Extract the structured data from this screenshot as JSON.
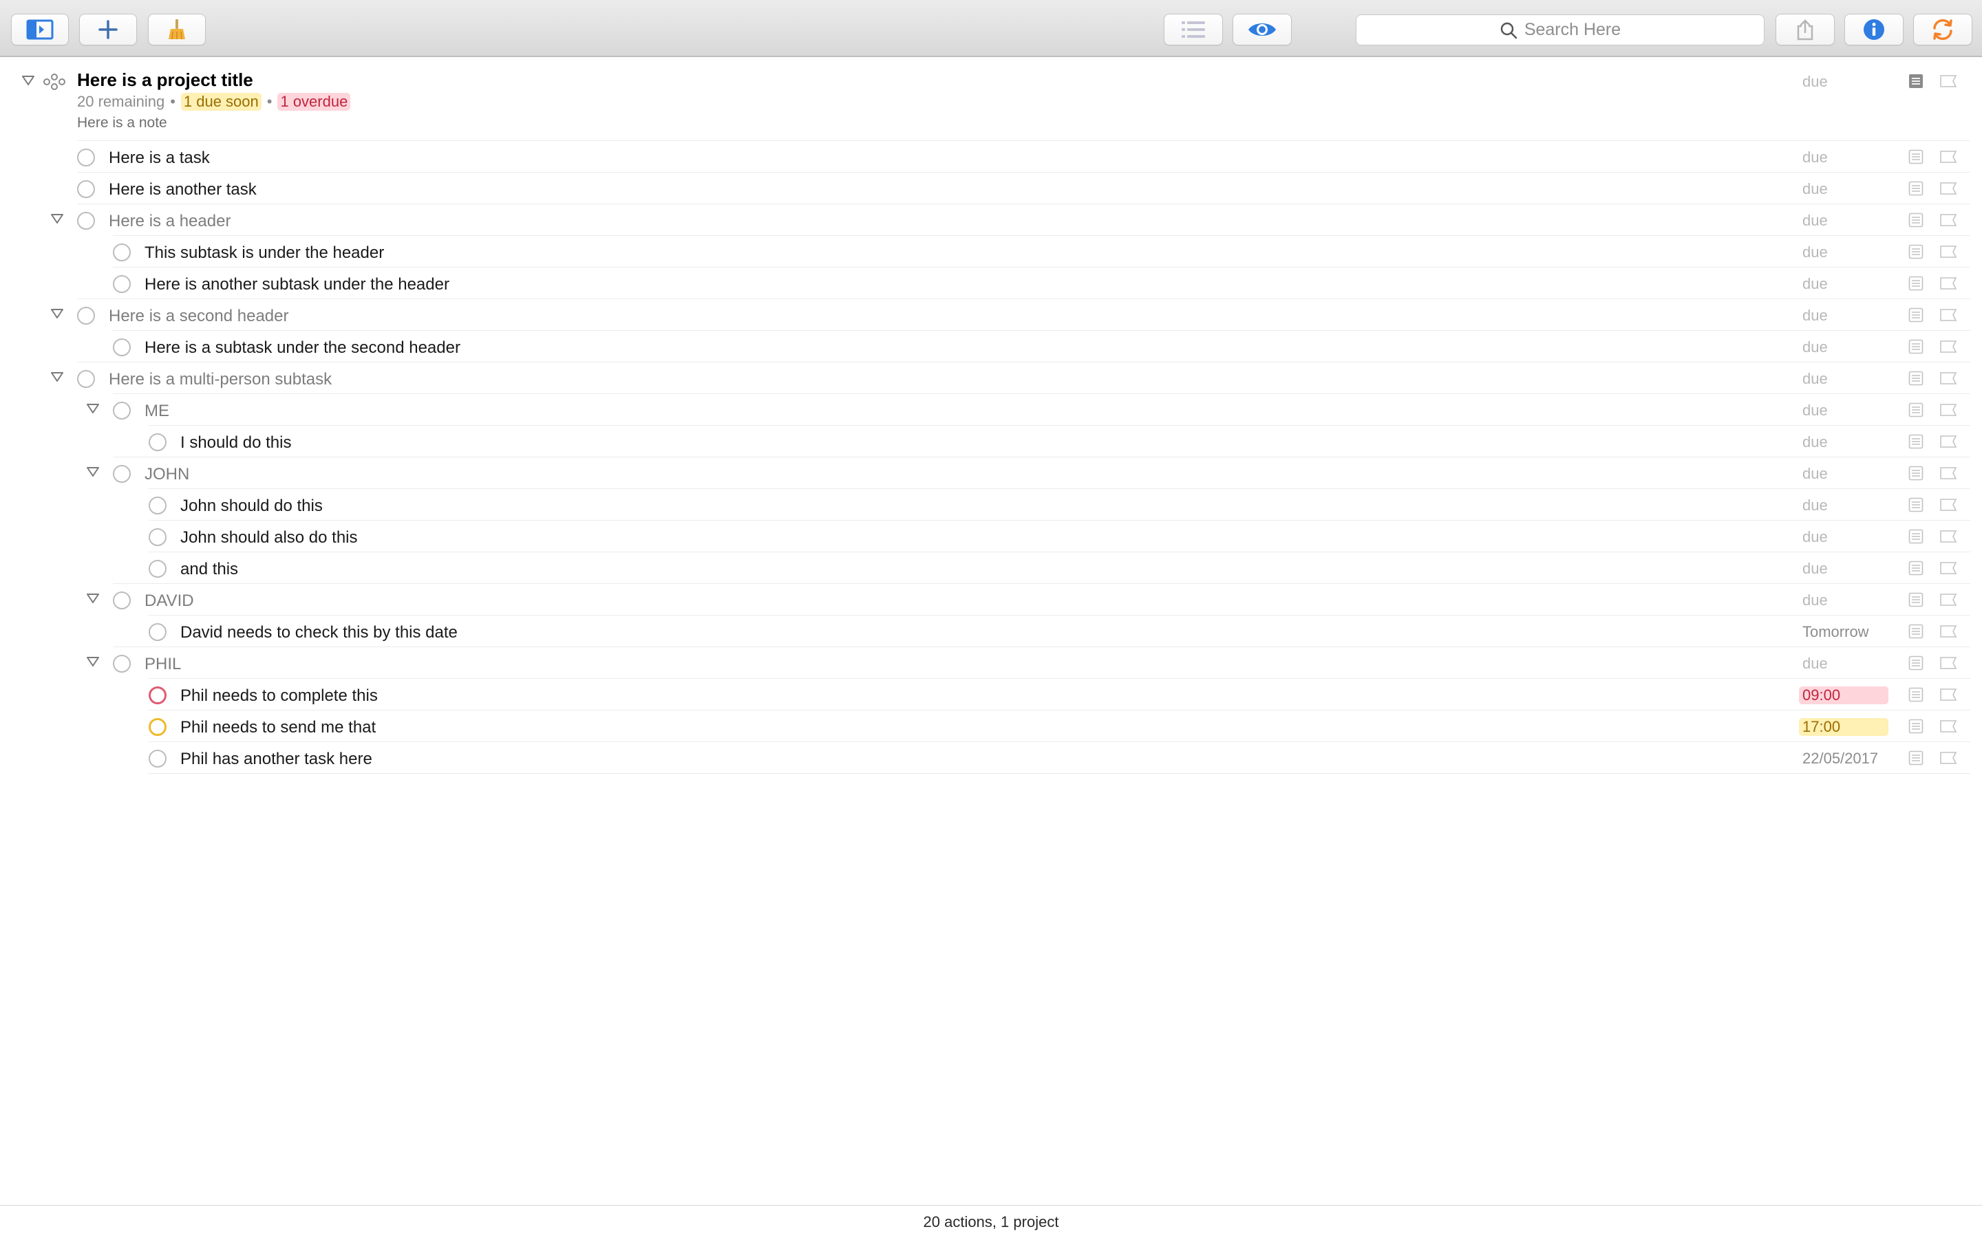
{
  "toolbar": {
    "buttons": [
      {
        "name": "sidebar-toggle-button",
        "icon": "sidebar-icon"
      },
      {
        "name": "add-button",
        "icon": "plus-icon"
      },
      {
        "name": "clean-up-button",
        "icon": "broom-icon"
      },
      {
        "name": "view-options-button",
        "icon": "list-icon"
      },
      {
        "name": "perspective-button",
        "icon": "eye-icon"
      },
      {
        "name": "share-button",
        "icon": "share-icon"
      },
      {
        "name": "inspector-button",
        "icon": "info-icon"
      },
      {
        "name": "sync-button",
        "icon": "sync-icon"
      }
    ],
    "search_placeholder": "Search Here"
  },
  "project": {
    "title": "Here is a project title",
    "remaining": "20 remaining",
    "separator": "•",
    "due_soon": "1 due soon",
    "overdue": "1 overdue",
    "note": "Here is a note",
    "due": "due"
  },
  "rows": [
    {
      "label": "Here is a task",
      "level": 0,
      "group": false,
      "due": "due",
      "due_style": "placeholder"
    },
    {
      "label": "Here is another task",
      "level": 0,
      "group": false,
      "due": "due",
      "due_style": "placeholder"
    },
    {
      "label": "Here is a header",
      "level": 0,
      "group": true,
      "due": "due",
      "due_style": "placeholder"
    },
    {
      "label": "This subtask is under the header",
      "level": 1,
      "group": false,
      "due": "due",
      "due_style": "placeholder"
    },
    {
      "label": "Here is another subtask under the header",
      "level": 1,
      "group": false,
      "due": "due",
      "due_style": "placeholder"
    },
    {
      "label": "Here is a second header",
      "level": 0,
      "group": true,
      "due": "due",
      "due_style": "placeholder"
    },
    {
      "label": "Here is a subtask under the second header",
      "level": 1,
      "group": false,
      "due": "due",
      "due_style": "placeholder"
    },
    {
      "label": "Here is a multi-person subtask",
      "level": 0,
      "group": true,
      "due": "due",
      "due_style": "placeholder"
    },
    {
      "label": "ME",
      "level": 1,
      "group": true,
      "due": "due",
      "due_style": "placeholder"
    },
    {
      "label": "I should do this",
      "level": 2,
      "group": false,
      "due": "due",
      "due_style": "placeholder"
    },
    {
      "label": "JOHN",
      "level": 1,
      "group": true,
      "due": "due",
      "due_style": "placeholder"
    },
    {
      "label": "John should do this",
      "level": 2,
      "group": false,
      "due": "due",
      "due_style": "placeholder"
    },
    {
      "label": "John should also do this",
      "level": 2,
      "group": false,
      "due": "due",
      "due_style": "placeholder"
    },
    {
      "label": "and this",
      "level": 2,
      "group": false,
      "due": "due",
      "due_style": "placeholder"
    },
    {
      "label": "DAVID",
      "level": 1,
      "group": true,
      "due": "due",
      "due_style": "placeholder"
    },
    {
      "label": "David needs to check this by this date",
      "level": 2,
      "group": false,
      "due": "Tomorrow",
      "due_style": "date"
    },
    {
      "label": "PHIL",
      "level": 1,
      "group": true,
      "due": "due",
      "due_style": "placeholder"
    },
    {
      "label": "Phil needs to complete this",
      "level": 2,
      "group": false,
      "due": "09:00",
      "due_style": "overdue",
      "status": "overdue"
    },
    {
      "label": "Phil needs to send me that",
      "level": 2,
      "group": false,
      "due": "17:00",
      "due_style": "due-soon",
      "status": "due-soon"
    },
    {
      "label": "Phil has another task here",
      "level": 2,
      "group": false,
      "due": "22/05/2017",
      "due_style": "date"
    }
  ],
  "colors": {
    "overdue": "#e05a70",
    "due_soon": "#f0b92a",
    "accent_blue": "#2f7de1",
    "sync_orange": "#f5822a"
  },
  "status_bar": "20 actions, 1 project"
}
